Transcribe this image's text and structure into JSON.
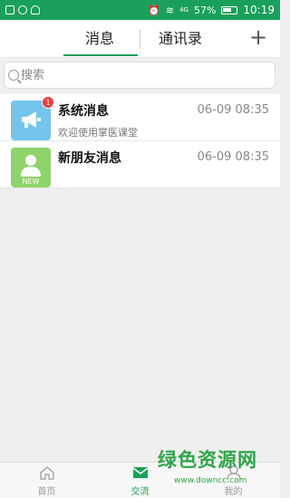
{
  "status_bar": {
    "battery": "57%",
    "time": "10:19",
    "network": "4G"
  },
  "header": {
    "tabs": [
      {
        "label": "消息",
        "active": true
      },
      {
        "label": "通讯录",
        "active": false
      }
    ],
    "add_button": "+"
  },
  "search": {
    "placeholder": "搜索"
  },
  "messages": [
    {
      "title": "系统消息",
      "subtitle": "欢迎使用掌医课堂",
      "time": "06-09 08:35",
      "badge": "1",
      "avatar_icon": "megaphone-icon",
      "avatar_color": "#74c4ee"
    },
    {
      "title": "新朋友消息",
      "subtitle": "",
      "time": "06-09 08:35",
      "avatar_icon": "person-icon",
      "avatar_label": "NEW",
      "avatar_color": "#8ed36a"
    }
  ],
  "bottom_nav": [
    {
      "label": "首页",
      "icon": "home-icon",
      "active": false
    },
    {
      "label": "交流",
      "icon": "mail-icon",
      "active": true
    },
    {
      "label": "我的",
      "icon": "user-icon",
      "active": false
    }
  ],
  "watermark": {
    "title": "绿色资源网",
    "url": "www.downcc.com"
  },
  "colors": {
    "accent": "#1aa05a",
    "badge": "#ee3b3b"
  }
}
